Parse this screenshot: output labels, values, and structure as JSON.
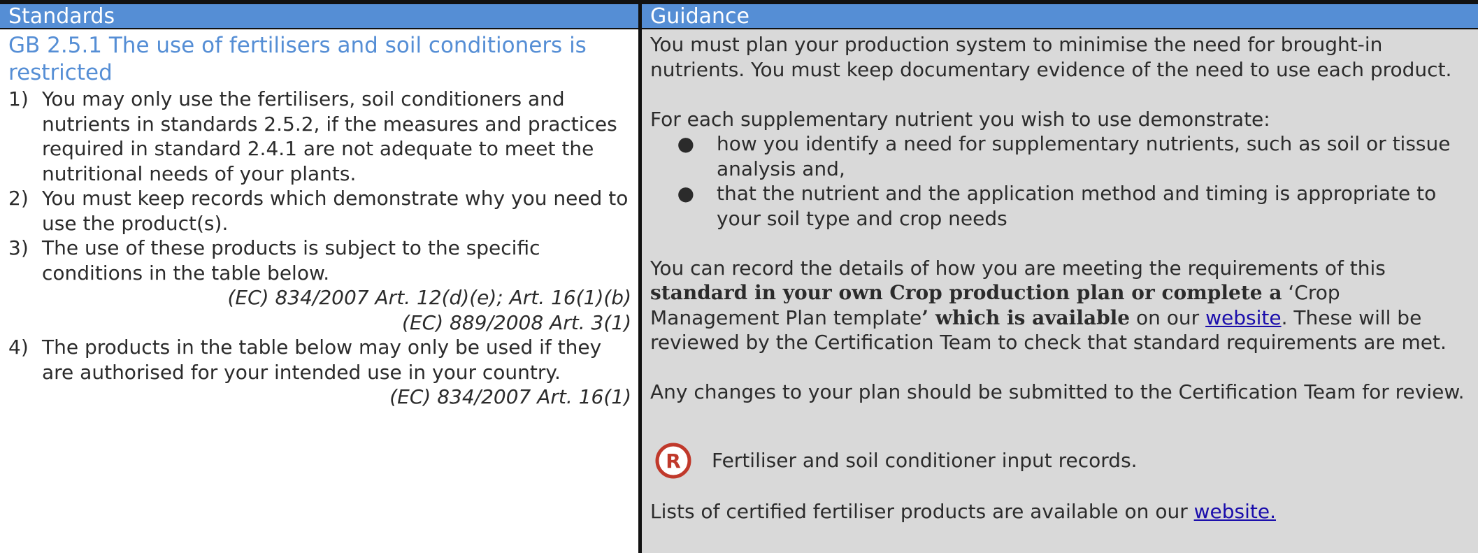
{
  "standards": {
    "header": "Standards",
    "title": "GB 2.5.1 The use of fertilisers and soil conditioners is restricted",
    "items": [
      {
        "num": "1)",
        "text": "You may only use the fertilisers, soil conditioners and nutrients in standards 2.5.2, if the measures and practices required in standard 2.4.1 are not adequate to meet the nutritional needs of your plants."
      },
      {
        "num": "2)",
        "text": "You must keep records which demonstrate why you need to use the product(s)."
      },
      {
        "num": "3)",
        "text": "The use of these products is subject to the specific conditions in the table below."
      }
    ],
    "ref1": "(EC) 834/2007 Art. 12(d)(e); Art. 16(1)(b)",
    "ref2": "(EC) 889/2008 Art. 3(1)",
    "item4": {
      "num": "4)",
      "text": "The products in the table below may only be used if they are authorised for your intended use in your country."
    },
    "ref3": "(EC) 834/2007 Art. 16(1)"
  },
  "guidance": {
    "header": "Guidance",
    "p1": "You must plan your production system to minimise the need for brought-in nutrients. You must keep documentary evidence of the need to use each product.",
    "p2": "For each supplementary nutrient you wish to use demonstrate:",
    "bullets": [
      "how you identify a need for supplementary nutrients, such as soil or tissue analysis and,",
      "that the nutrient and the application method and timing is appropriate to your soil type and crop needs"
    ],
    "p3_a": "You can record the details of how you are meeting the requirements of this ",
    "p3_b": "standard in your own Crop production plan or complete a",
    "p3_c": " ‘Crop Management Plan template",
    "p3_d": "’ which is available",
    "p3_e": " on our ",
    "p3_link": "website",
    "p3_f": ". These will be reviewed by the Certification Team to check that standard requirements are met.",
    "p4": "Any changes to your plan should be submitted to the Certification Team for review.",
    "record_icon_letter": "R",
    "record_text": "Fertiliser and soil conditioner input records.",
    "p5_a": "Lists of certified fertiliser products are available on our ",
    "p5_link": "website."
  },
  "colors": {
    "header_bg": "#558ed5",
    "title": "#558ed5",
    "guidance_bg": "#d9d9d9",
    "record_icon": "#c0392b"
  }
}
